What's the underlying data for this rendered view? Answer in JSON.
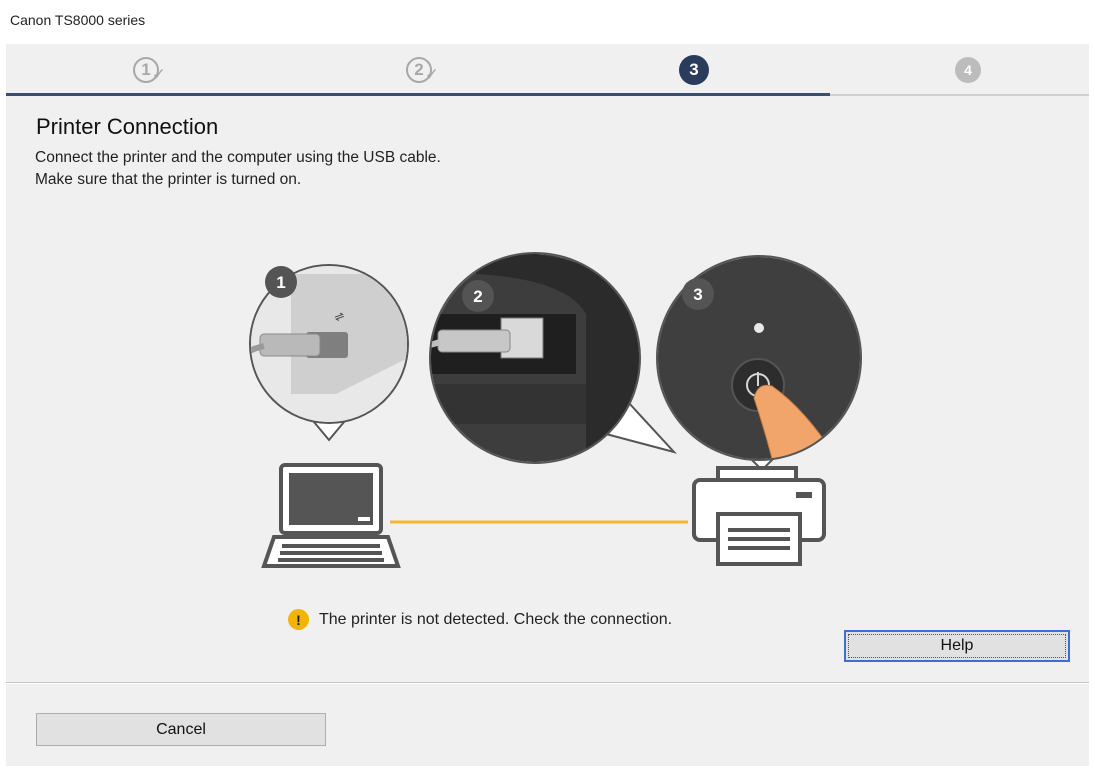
{
  "window": {
    "title": "Canon TS8000 series"
  },
  "wizard": {
    "steps": [
      {
        "number": "1",
        "state": "done"
      },
      {
        "number": "2",
        "state": "done"
      },
      {
        "number": "3",
        "state": "current"
      },
      {
        "number": "4",
        "state": "future"
      }
    ],
    "check_mark": "✓"
  },
  "page": {
    "heading": "Printer Connection",
    "instructions": [
      "Connect the printer and the computer using the USB cable.",
      "Make sure that the printer is turned on."
    ]
  },
  "illustration": {
    "callouts": [
      {
        "number": "1",
        "icon": "usb-plug-icon"
      },
      {
        "number": "2",
        "icon": "usb-port-icon"
      },
      {
        "number": "3",
        "icon": "power-button-icon"
      }
    ],
    "devices": [
      "laptop-icon",
      "printer-icon"
    ],
    "cable_color": "#f5b732"
  },
  "status": {
    "message": "The printer is not detected. Check the connection.",
    "icon": "warning-icon",
    "icon_glyph": "!",
    "icon_color": "#f1b400"
  },
  "buttons": {
    "help": "Help",
    "cancel": "Cancel"
  },
  "colors": {
    "progress": "#3b4d72",
    "current_step": "#2b3b5c",
    "focus_border": "#3a6fd6"
  }
}
